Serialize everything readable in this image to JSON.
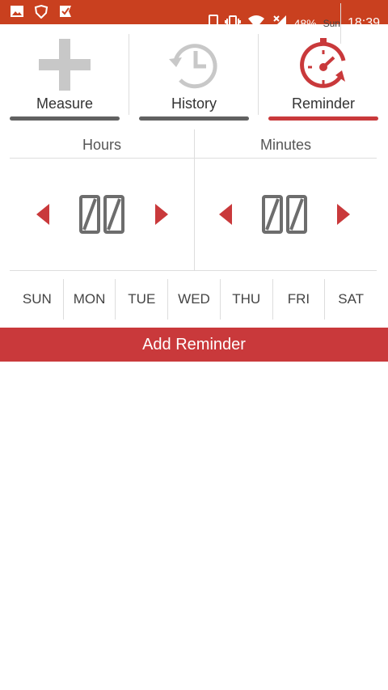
{
  "status_bar": {
    "battery_percent": "48%",
    "day": "Sun",
    "time": "18:39",
    "icons": [
      "image-icon",
      "shield-icon",
      "check-flag-icon",
      "phone-icon",
      "vibrate-icon",
      "wifi-icon",
      "signal-icon"
    ]
  },
  "tabs": [
    {
      "label": "Measure",
      "icon": "plus-icon",
      "active": false
    },
    {
      "label": "History",
      "icon": "clock-history-icon",
      "active": false
    },
    {
      "label": "Reminder",
      "icon": "stopwatch-icon",
      "active": true
    }
  ],
  "time_setter": {
    "hours": {
      "label": "Hours",
      "value": "00"
    },
    "minutes": {
      "label": "Minutes",
      "value": "00"
    }
  },
  "days": [
    "SUN",
    "MON",
    "TUE",
    "WED",
    "THU",
    "FRI",
    "SAT"
  ],
  "add_button_label": "Add Reminder",
  "colors": {
    "status_bar": "#c9401f",
    "accent": "#c9393b",
    "inactive_underline": "#616161",
    "icon_gray": "#c8c8c8"
  }
}
